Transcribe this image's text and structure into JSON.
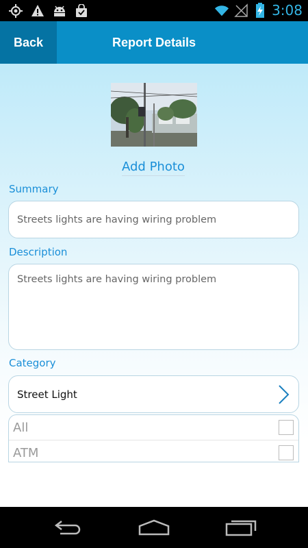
{
  "status_bar": {
    "icons_left": [
      "gps-icon",
      "warning-icon",
      "android-icon",
      "shopping-bag-icon"
    ],
    "icons_right": [
      "wifi-icon",
      "signal-icon",
      "battery-charging-icon"
    ],
    "time": "3:08",
    "accent_color": "#33b5e5"
  },
  "header": {
    "back_label": "Back",
    "title": "Report Details",
    "color": "#0a8fc7",
    "back_color": "#0573a3"
  },
  "photo": {
    "add_photo_label": "Add Photo"
  },
  "summary": {
    "label": "Summary",
    "value": "Streets lights are having wiring problem"
  },
  "description": {
    "label": "Description",
    "value": "Streets lights are having wiring problem"
  },
  "category": {
    "label": "Category",
    "selected": "Street Light",
    "options": [
      {
        "label": "All",
        "checked": false
      },
      {
        "label": "ATM",
        "checked": false
      }
    ]
  },
  "nav_bar": {
    "buttons": [
      "back-icon",
      "home-icon",
      "recent-apps-icon"
    ]
  }
}
